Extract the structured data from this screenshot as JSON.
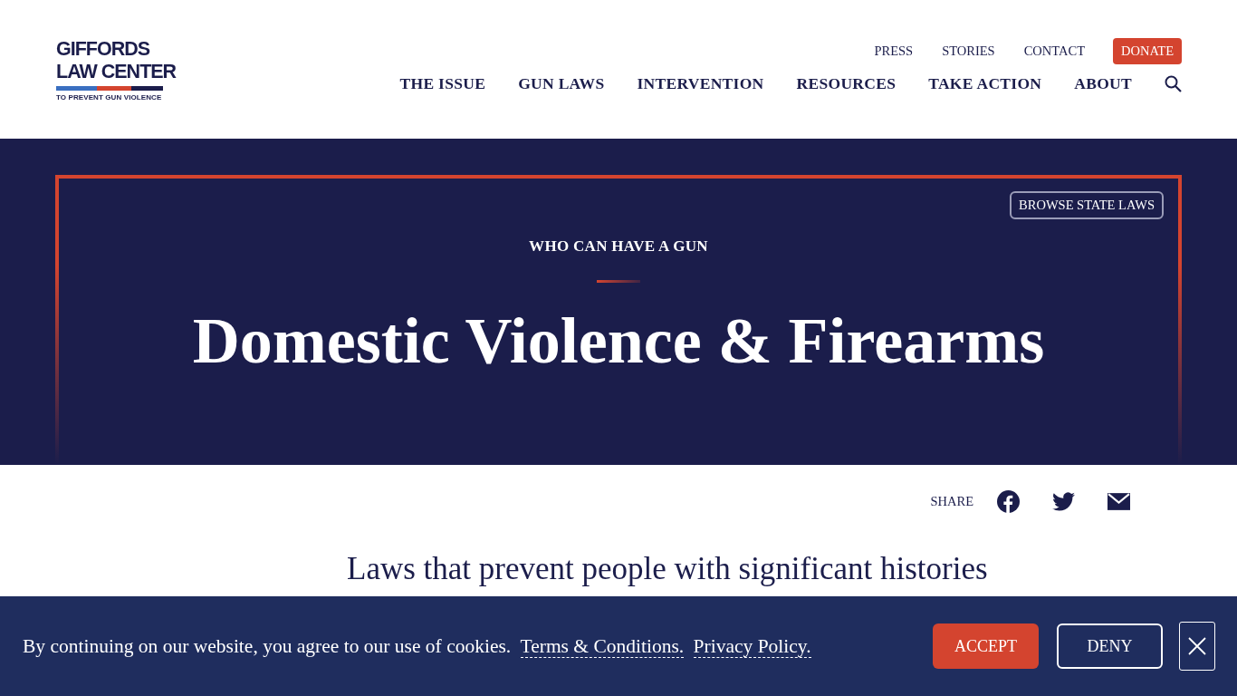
{
  "logo": {
    "name_line_1": "GIFFORDS",
    "name_line_2": "LAW CENTER",
    "tagline": "TO PREVENT GUN VIOLENCE"
  },
  "utility_nav": [
    "PRESS",
    "STORIES",
    "CONTACT"
  ],
  "donate_button": "DONATE",
  "main_nav": [
    "THE ISSUE",
    "GUN LAWS",
    "INTERVENTION",
    "RESOURCES",
    "TAKE ACTION",
    "ABOUT"
  ],
  "hero": {
    "browse_button": "BROWSE STATE LAWS",
    "eyebrow": "WHO CAN HAVE A GUN",
    "title": "Domestic Violence & Firearms"
  },
  "share": {
    "label": "SHARE",
    "links": [
      {
        "kind": "facebook"
      },
      {
        "kind": "twitter"
      },
      {
        "kind": "email"
      }
    ]
  },
  "intro": "Laws that prevent people with significant histories",
  "cookie_banner": {
    "message": "By continuing on our website, you agree to our use of cookies.",
    "links": [
      "Terms & Conditions.",
      "Privacy Policy."
    ],
    "accept": "ACCEPT",
    "deny": "DENY"
  }
}
